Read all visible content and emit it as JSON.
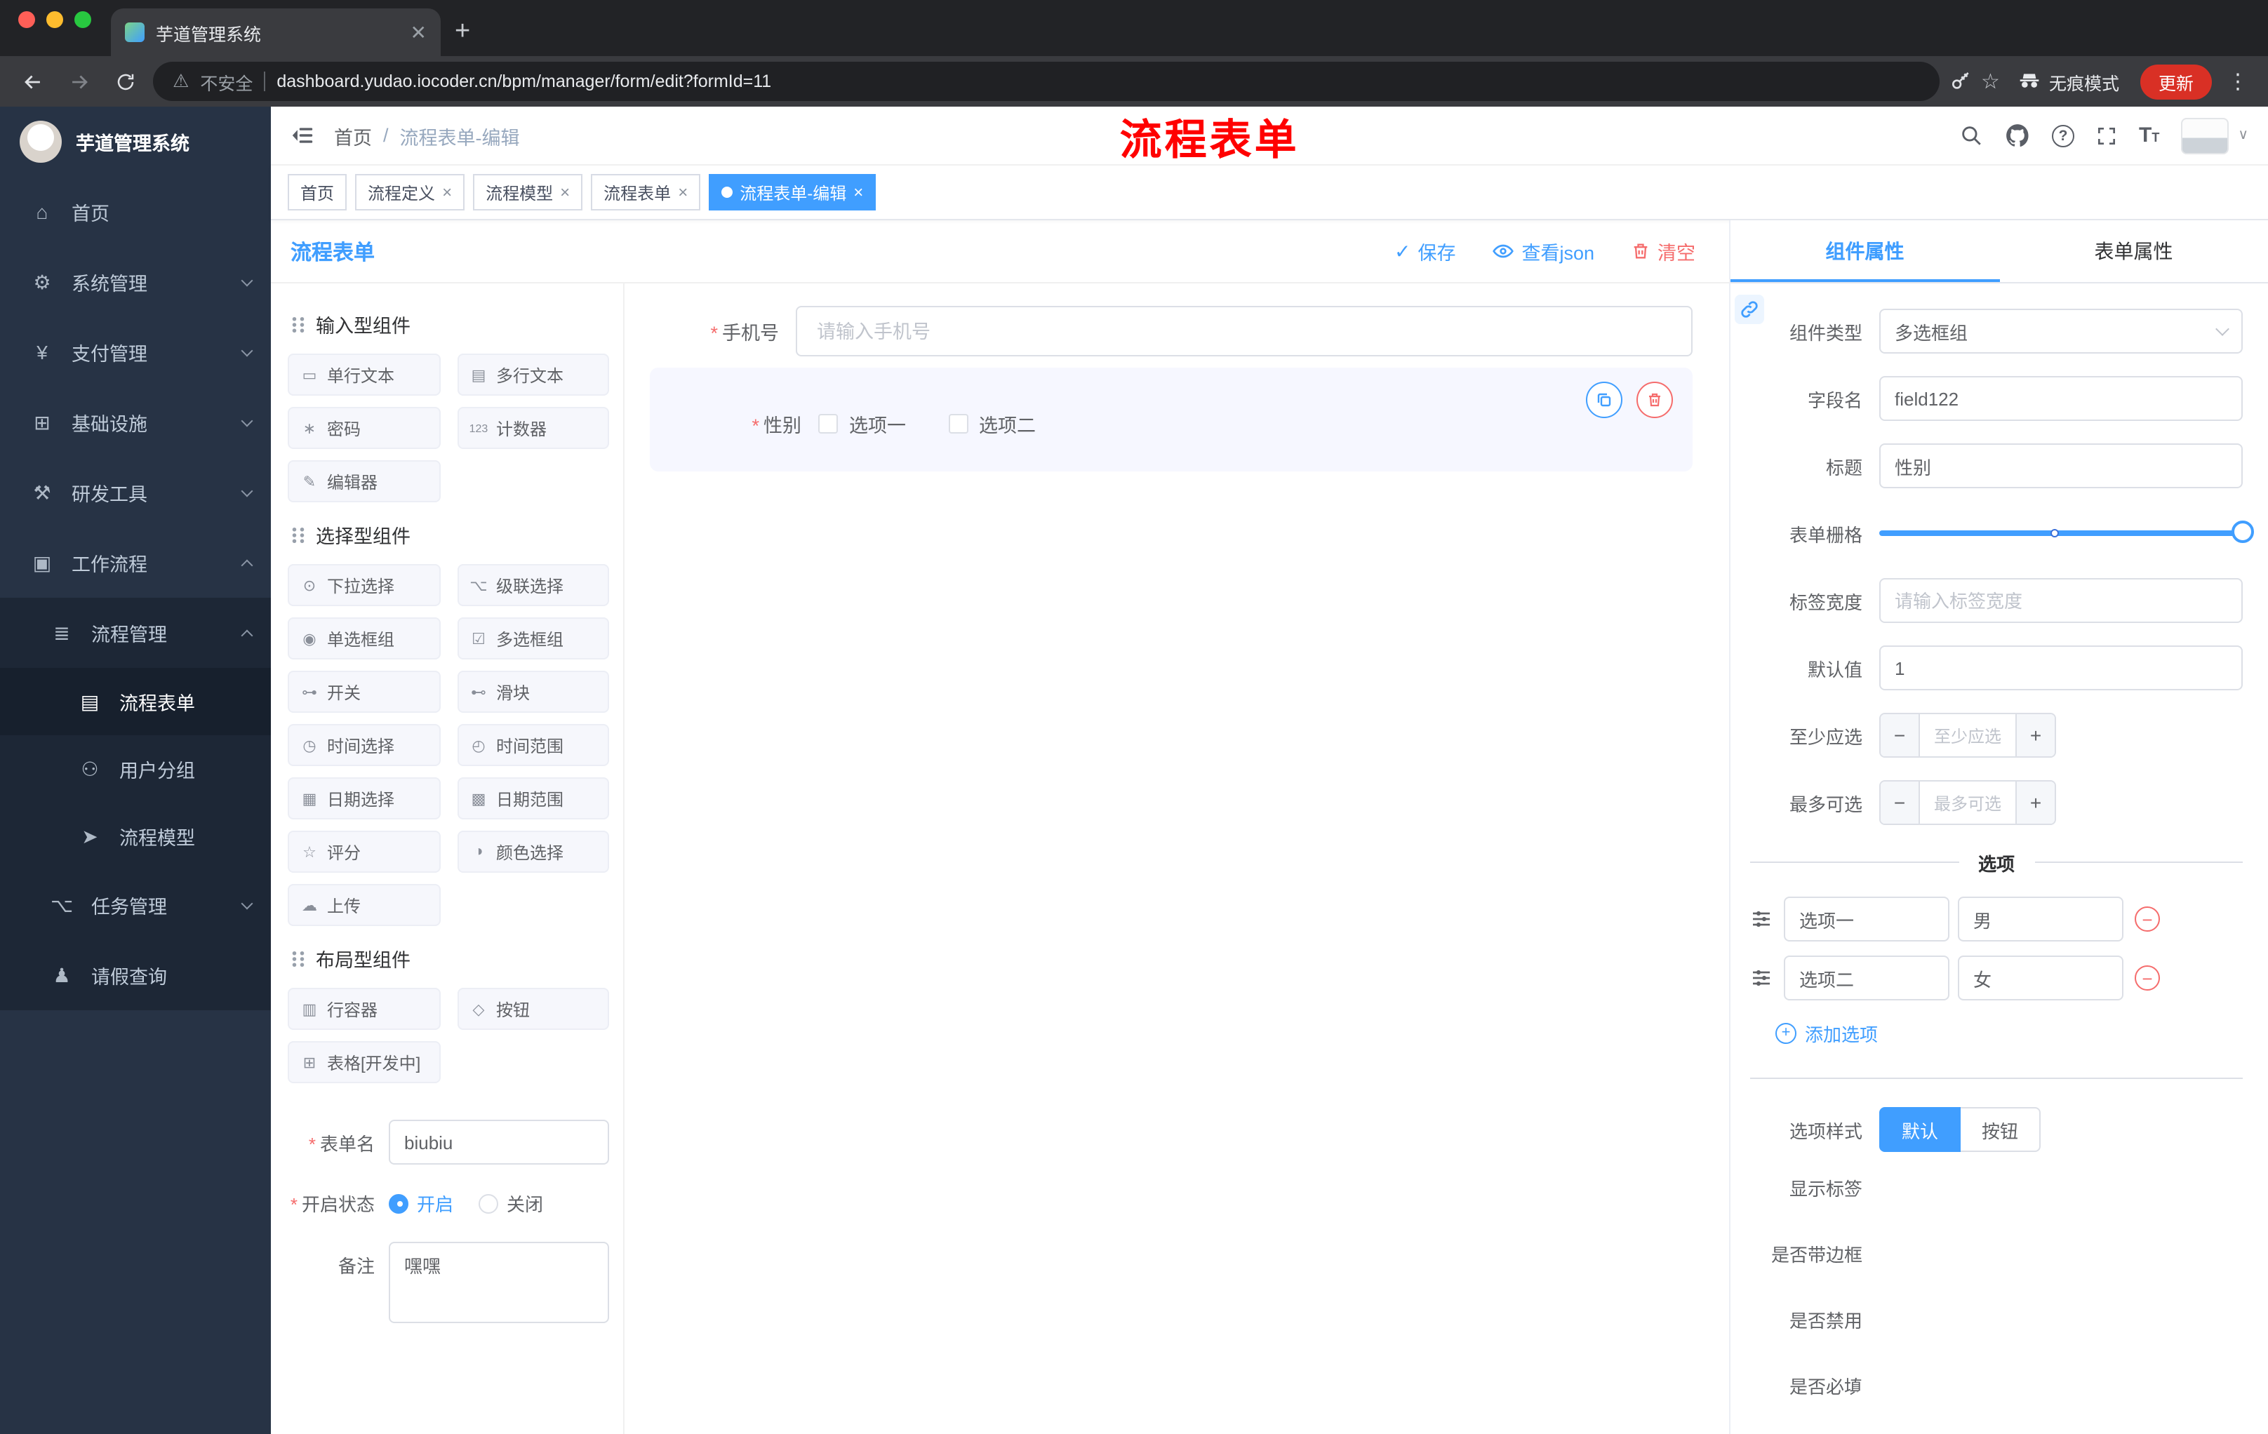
{
  "colors": {
    "primary": "#409eff",
    "danger": "#f56c6c",
    "annotation": "#ff0000"
  },
  "browser": {
    "tab_title": "芋道管理系统",
    "security_label": "不安全",
    "url": "dashboard.yudao.iocoder.cn/bpm/manager/form/edit?formId=11",
    "incognito_label": "无痕模式",
    "update_label": "更新"
  },
  "sidebar": {
    "logo_title": "芋道管理系统",
    "items": [
      {
        "icon": "⌂",
        "label": "首页"
      },
      {
        "icon": "⚙",
        "label": "系统管理"
      },
      {
        "icon": "¥",
        "label": "支付管理"
      },
      {
        "icon": "⊞",
        "label": "基础设施"
      },
      {
        "icon": "⚒",
        "label": "研发工具"
      },
      {
        "icon": "▣",
        "label": "工作流程"
      }
    ],
    "sub": {
      "process": {
        "icon": "≣",
        "label": "流程管理",
        "children": [
          {
            "icon": "▤",
            "label": "流程表单"
          },
          {
            "icon": "⚇",
            "label": "用户分组"
          },
          {
            "icon": "➤",
            "label": "流程模型"
          }
        ]
      },
      "task": {
        "icon": "⌥",
        "label": "任务管理"
      },
      "leave": {
        "icon": "♟",
        "label": "请假查询"
      }
    }
  },
  "header": {
    "breadcrumb": [
      "首页",
      "流程表单-编辑"
    ],
    "separator": "/",
    "annotation": "流程表单"
  },
  "tags": [
    {
      "label": "首页"
    },
    {
      "label": "流程定义"
    },
    {
      "label": "流程模型"
    },
    {
      "label": "流程表单"
    },
    {
      "label": "流程表单-编辑"
    }
  ],
  "designer": {
    "panel_title": "流程表单",
    "actions": {
      "save": "保存",
      "view_json": "查看json",
      "clear": "清空"
    },
    "groups": [
      {
        "title": "输入型组件",
        "items": [
          {
            "icon": "▭",
            "label": "单行文本"
          },
          {
            "icon": "▤",
            "label": "多行文本"
          },
          {
            "icon": "∗",
            "label": "密码"
          },
          {
            "icon": "123",
            "label": "计数器"
          },
          {
            "icon": "✎",
            "label": "编辑器"
          }
        ]
      },
      {
        "title": "选择型组件",
        "items": [
          {
            "icon": "⊙",
            "label": "下拉选择"
          },
          {
            "icon": "⌥",
            "label": "级联选择"
          },
          {
            "icon": "◉",
            "label": "单选框组"
          },
          {
            "icon": "☑",
            "label": "多选框组"
          },
          {
            "icon": "⊶",
            "label": "开关"
          },
          {
            "icon": "⊷",
            "label": "滑块"
          },
          {
            "icon": "◷",
            "label": "时间选择"
          },
          {
            "icon": "◴",
            "label": "时间范围"
          },
          {
            "icon": "▦",
            "label": "日期选择"
          },
          {
            "icon": "▩",
            "label": "日期范围"
          },
          {
            "icon": "☆",
            "label": "评分"
          },
          {
            "icon": "◑",
            "label": "颜色选择"
          },
          {
            "icon": "☁",
            "label": "上传"
          }
        ]
      },
      {
        "title": "布局型组件",
        "items": [
          {
            "icon": "▥",
            "label": "行容器"
          },
          {
            "icon": "◇",
            "label": "按钮"
          },
          {
            "icon": "⊞",
            "label": "表格[开发中]"
          }
        ]
      }
    ],
    "meta": {
      "form_name_label": "表单名",
      "form_name_value": "biubiu",
      "status_label": "开启状态",
      "status_on": "开启",
      "status_off": "关闭",
      "remark_label": "备注",
      "remark_value": "嘿嘿"
    }
  },
  "canvas": {
    "phone_label": "手机号",
    "phone_placeholder": "请输入手机号",
    "gender_label": "性别",
    "gender_options": [
      "选项一",
      "选项二"
    ]
  },
  "props": {
    "tab_component": "组件属性",
    "tab_form": "表单属性",
    "type_label": "组件类型",
    "type_value": "多选框组",
    "field_label": "字段名",
    "field_value": "field122",
    "title_label": "标题",
    "title_value": "性别",
    "grid_label": "表单栅格",
    "width_label": "标签宽度",
    "width_placeholder": "请输入标签宽度",
    "default_label": "默认值",
    "default_value": "1",
    "min_label": "至少应选",
    "min_placeholder": "至少应选",
    "max_label": "最多可选",
    "max_placeholder": "最多可选",
    "options_divider": "选项",
    "options": [
      {
        "label": "选项一",
        "value": "男"
      },
      {
        "label": "选项二",
        "value": "女"
      }
    ],
    "add_option": "添加选项",
    "style_label": "选项样式",
    "style_default": "默认",
    "style_button": "按钮",
    "switches": [
      {
        "label": "显示标签"
      },
      {
        "label": "是否带边框"
      },
      {
        "label": "是否禁用"
      },
      {
        "label": "是否必填"
      }
    ]
  }
}
